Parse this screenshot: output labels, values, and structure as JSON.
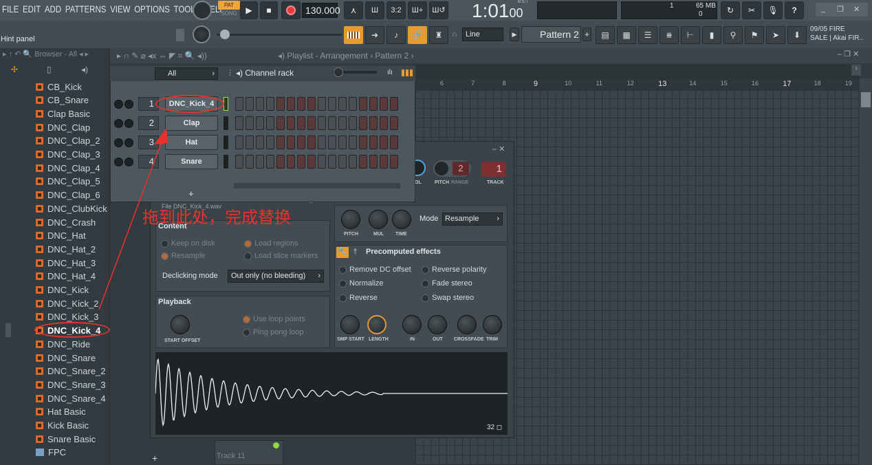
{
  "menu": [
    "FILE",
    "EDIT",
    "ADD",
    "PATTERNS",
    "VIEW",
    "OPTIONS",
    "TOOLS",
    "HELP"
  ],
  "transport": {
    "pat": "PAT",
    "song": "SONG",
    "tempo": "130.000",
    "time": "1:01",
    "time_small": "00",
    "bst": "B:S:T"
  },
  "status": {
    "mem": "65 MB",
    "cpu": "1",
    "poly": "0"
  },
  "hint": "Hint panel",
  "snap": "Line",
  "pattern_name": "Pattern 2",
  "news": {
    "line1": "09/05  FIRE",
    "line2": "SALE | Akai FIR.."
  },
  "browser": {
    "title": "Browser - All",
    "items": [
      "CB_Kick",
      "CB_Snare",
      "Clap Basic",
      "DNC_Clap",
      "DNC_Clap_2",
      "DNC_Clap_3",
      "DNC_Clap_4",
      "DNC_Clap_5",
      "DNC_Clap_6",
      "DNC_ClubKick",
      "DNC_Crash",
      "DNC_Hat",
      "DNC_Hat_2",
      "DNC_Hat_3",
      "DNC_Hat_4",
      "DNC_Kick",
      "DNC_Kick_2",
      "DNC_Kick_3",
      "DNC_Kick_4",
      "DNC_Ride",
      "DNC_Snare",
      "DNC_Snare_2",
      "DNC_Snare_3",
      "DNC_Snare_4",
      "Hat Basic",
      "Kick Basic",
      "Snare Basic"
    ],
    "folder": "FPC"
  },
  "playlist": {
    "title": "Playlist - Arrangement",
    "pattern": "Pattern 2",
    "ruler": [
      "6",
      "7",
      "8",
      "9",
      "10",
      "11",
      "12",
      "13",
      "14",
      "15",
      "16",
      "17",
      "18",
      "19"
    ],
    "track": "Track 11"
  },
  "rack": {
    "title": "Channel rack",
    "filter": "All",
    "channels": [
      {
        "num": "1",
        "name": "DNC_Kick_4"
      },
      {
        "num": "2",
        "name": "Clap"
      },
      {
        "num": "3",
        "name": "Hat"
      },
      {
        "num": "4",
        "name": "Snare"
      }
    ],
    "add": "+"
  },
  "annotation": "拖到此处，完成替换",
  "sampler": {
    "file_label": "File",
    "file_name": "DNC_Kick_4.wav",
    "pitch_val": "2",
    "track_val": "1",
    "hdr_vol": "OL",
    "hdr_pitch": "PITCH",
    "hdr_range": "RANGE",
    "hdr_track": "TRACK",
    "content_title": "Content",
    "keep_on_disk": "Keep on disk",
    "load_regions": "Load regions",
    "resample": "Resample",
    "load_slice": "Load slice markers",
    "declick_label": "Declicking mode",
    "declick_val": "Out only (no bleeding)",
    "playback_title": "Playback",
    "use_loop": "Use loop points",
    "ping_pong": "Ping pong loop",
    "start_offset": "START OFFSET",
    "k_pitch": "PITCH",
    "k_mul": "MUL",
    "k_time": "TIME",
    "mode_label": "Mode",
    "mode_val": "Resample",
    "precomp_title": "Precomputed effects",
    "remove_dc": "Remove DC offset",
    "reverse_pol": "Reverse polarity",
    "normalize": "Normalize",
    "fade_stereo": "Fade stereo",
    "reverse": "Reverse",
    "swap_stereo": "Swap stereo",
    "k_smp": "SMP START",
    "k_len": "LENGTH",
    "k_in": "IN",
    "k_out": "OUT",
    "k_xf": "CROSSFADE",
    "k_trim": "TRIM",
    "wave_num": "32"
  }
}
